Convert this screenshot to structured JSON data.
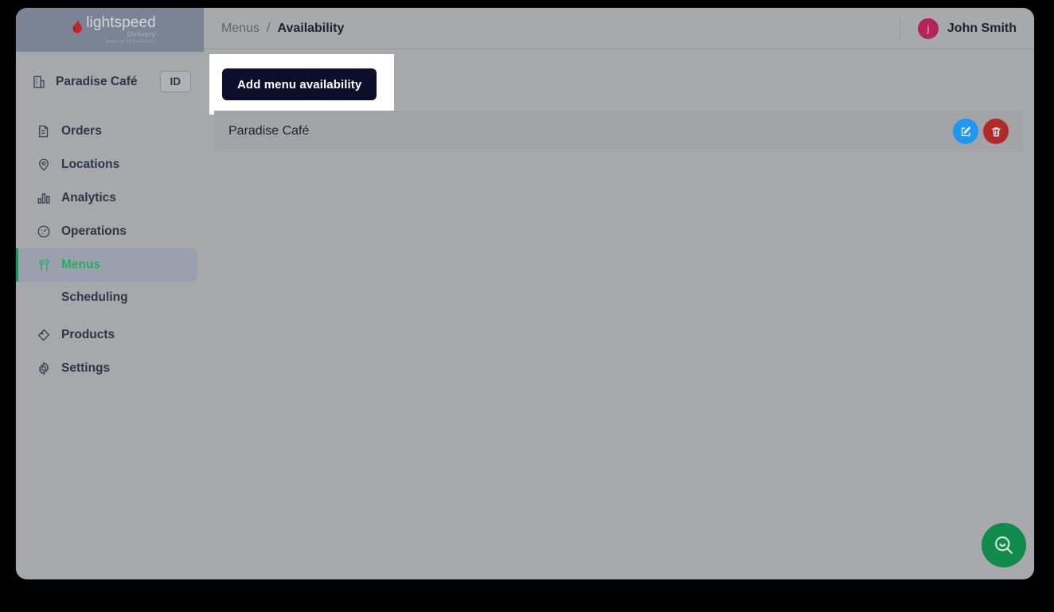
{
  "brand": {
    "logo_main": "lightspeed",
    "logo_sub": "Delivery",
    "logo_sub2": "powered by Deliverect",
    "accent_green": "#0f9d58",
    "accent_dark": "#0d0e2b",
    "avatar_color": "#b4245c"
  },
  "sidebar": {
    "store": {
      "name": "Paradise Café",
      "icon": "store-icon",
      "badge": "ID"
    },
    "items": [
      {
        "label": "Orders",
        "icon": "orders-icon",
        "active": false
      },
      {
        "label": "Locations",
        "icon": "location-pin-icon",
        "active": false
      },
      {
        "label": "Analytics",
        "icon": "analytics-icon",
        "active": false
      },
      {
        "label": "Operations",
        "icon": "gauge-icon",
        "active": false
      },
      {
        "label": "Menus",
        "icon": "cutlery-icon",
        "active": true
      },
      {
        "label": "Products",
        "icon": "tag-icon",
        "active": false
      },
      {
        "label": "Settings",
        "icon": "gear-icon",
        "active": false
      }
    ],
    "sub_items": [
      {
        "label": "Scheduling",
        "parent": "Menus"
      }
    ]
  },
  "header": {
    "breadcrumb_parent": "Menus",
    "breadcrumb_separator": "/",
    "breadcrumb_current": "Availability",
    "user_initial": "j",
    "user_name": "John Smith"
  },
  "main": {
    "add_button_label": "Add menu availability",
    "rows": [
      {
        "title": "Paradise Café",
        "edit_label": "edit-icon",
        "delete_label": "trash-icon"
      }
    ]
  },
  "fab": {
    "icon": "search-smile-icon"
  }
}
